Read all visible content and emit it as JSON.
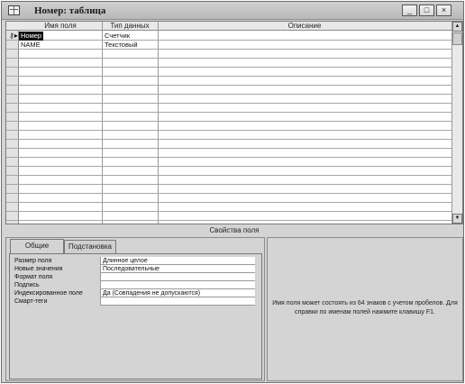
{
  "window": {
    "title": "Номер: таблица",
    "buttons": {
      "minimize": "_",
      "maximize": "□",
      "close": "×"
    }
  },
  "grid": {
    "columns": [
      "Имя поля",
      "Тип данных",
      "Описание"
    ],
    "rows": [
      {
        "name": "Номер",
        "type": "Счетчик",
        "desc": "",
        "key": true,
        "selected": true
      },
      {
        "name": "NAME",
        "type": "Текстовый",
        "desc": ""
      }
    ],
    "empty_rows": 19
  },
  "properties": {
    "title": "Свойства поля",
    "tabs": [
      "Общие",
      "Подстановка"
    ],
    "rows": [
      {
        "label": "Размер поля",
        "value": "Длинное целое"
      },
      {
        "label": "Новые значения",
        "value": "Последовательные"
      },
      {
        "label": "Формат поля",
        "value": ""
      },
      {
        "label": "Подпись",
        "value": ""
      },
      {
        "label": "Индексированное поле",
        "value": "Да (Совпадения не допускаются)"
      },
      {
        "label": "Смарт-теги",
        "value": ""
      }
    ],
    "help_text": "Имя поля может состоять из 64 знаков с учетом пробелов. Для справки по именам полей нажмите клавишу F1."
  }
}
